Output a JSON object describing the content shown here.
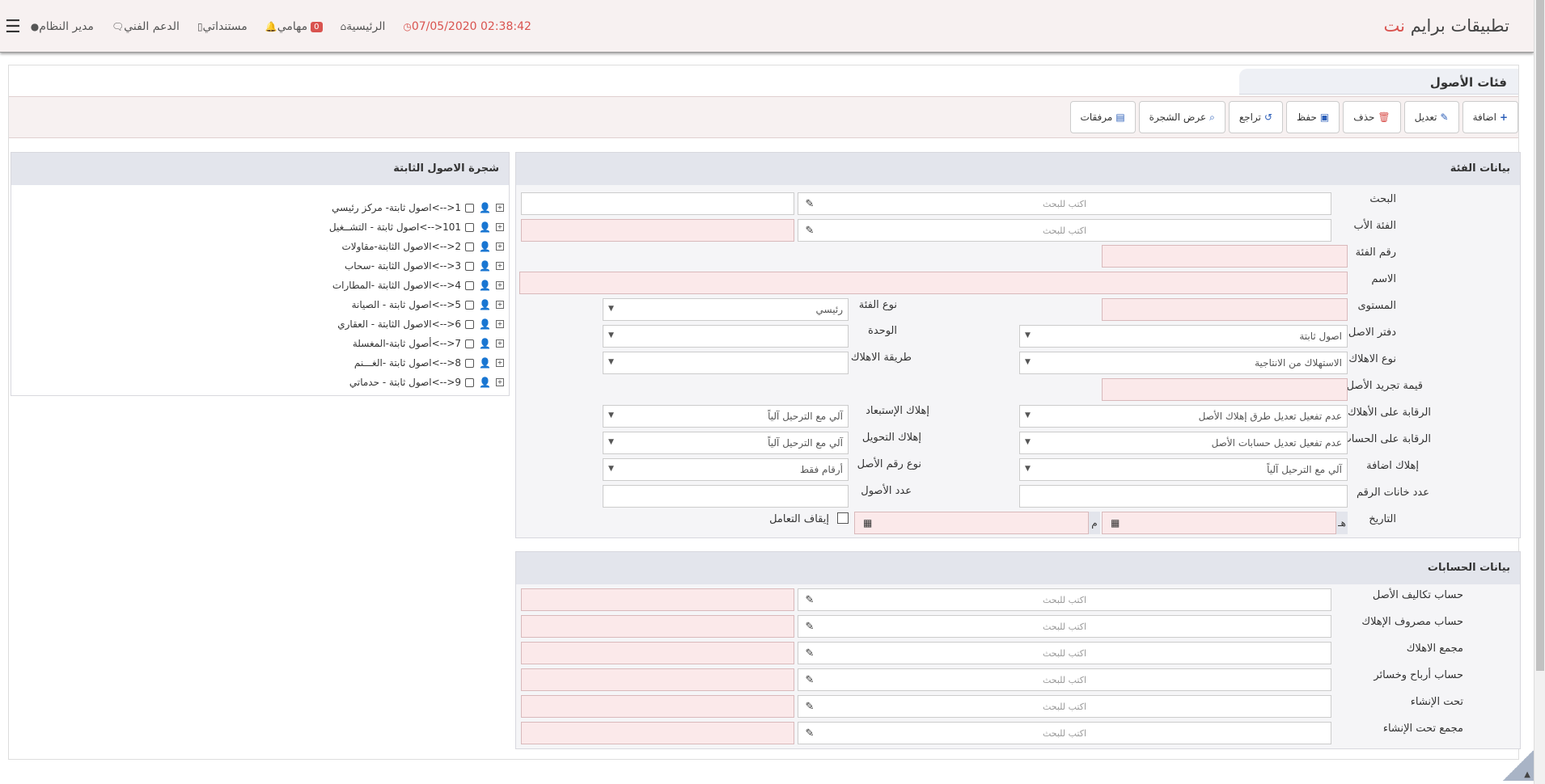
{
  "header": {
    "brand_main": "تطبيقات برايم ",
    "brand_accent": "نت",
    "user": "مدير النظام",
    "support": "الدعم الفني",
    "documents": "مستنداتي",
    "tasks": "مهامي",
    "notifications_count": "0",
    "home": "الرئيسية",
    "datetime": "07/05/2020 02:38:42"
  },
  "page": {
    "title": "فئات الأصول"
  },
  "toolbar": {
    "add": "اضافة",
    "edit": "تعديل",
    "delete": "حذف",
    "save": "حفظ",
    "undo": "تراجع",
    "show_tree": "عرض الشجرة",
    "attachments": "مرفقات"
  },
  "category_panel": {
    "title": "بيانات الفئة",
    "search_label": "البحث",
    "search_placeholder": "اكتب للبحث",
    "parent_label": "الفئة الأب",
    "parent_placeholder": "اكتب للبحث",
    "number_label": "رقم الفئة",
    "name_label": "الاسم",
    "level_label": "المستوى",
    "category_type_label": "نوع الفئة",
    "category_type_value": "رئيسي",
    "asset_book_label": "دفتر الاصل",
    "asset_book_value": "اصول ثابتة",
    "unit_label": "الوحدة",
    "depreciation_type_label": "نوع الاهلاك",
    "depreciation_type_value": "الاستهلاك من الانتاجية",
    "depreciation_method_label": "طريقة الاهلاك",
    "stripping_value_label": "قيمة تجريد الأصل",
    "depreciation_control_label": "الرقابة على الأهلاك",
    "depreciation_control_value": "عدم تفعيل تعديل طرق إهلاك الأصل",
    "disposal_depreciation_label": "إهلاك الإستبعاد",
    "disposal_depreciation_value": "آلي مع الترحيل آلياً",
    "account_control_label": "الرقابة على الحساب",
    "account_control_value": "عدم تفعيل تعديل حسابات الأصل",
    "transfer_depreciation_label": "إهلاك التحويل",
    "transfer_depreciation_value": "آلي مع الترحيل آلياً",
    "addition_depreciation_label": "إهلاك اضافة",
    "addition_depreciation_value": "آلي مع الترحيل آلياً",
    "asset_number_type_label": "نوع رقم الأصل",
    "asset_number_type_value": "أرقام فقط",
    "digits_count_label": "عدد خانات الرقم",
    "assets_count_label": "عدد الأصول",
    "date_label": "التاريخ",
    "hijri_suffix": "هـ",
    "gregorian_suffix": "م",
    "stop_dealing_label": "إيقاف التعامل"
  },
  "tree_panel": {
    "title": "شجرة الاصول الثابتة",
    "items": [
      "1<-->اصول ثابتة- مركز رئيسي",
      "101<-->اصول ثابتة - التشــغيل",
      "2<-->الاصول الثابتة-مقاولات",
      "3<-->الاصول الثابتة -سحاب",
      "4<-->الاصول الثابتة -المطارات",
      "5<-->اصول ثابتة - الصيانة",
      "6<-->الاصول الثابتة - العقاري",
      "7<-->أصول ثابتة-المغسلة",
      "8<-->اصول ثابتة -الغـــنم",
      "9<-->اصول ثابتة - حدماتي"
    ]
  },
  "accounts_panel": {
    "title": "بيانات الحسابات",
    "placeholder": "اكتب للبحث",
    "rows": [
      "حساب تكاليف الأصل",
      "حساب مصروف الإهلاك",
      "مجمع الاهلاك",
      "حساب أرباح وخسائر",
      "تحت الإنشاء",
      "مجمع تحت الإنشاء"
    ]
  },
  "colors": {
    "accent": "#d9534f",
    "link": "#2b5eb8",
    "required_bg": "#fbe9ea",
    "panel_head": "#e3e5ec"
  }
}
